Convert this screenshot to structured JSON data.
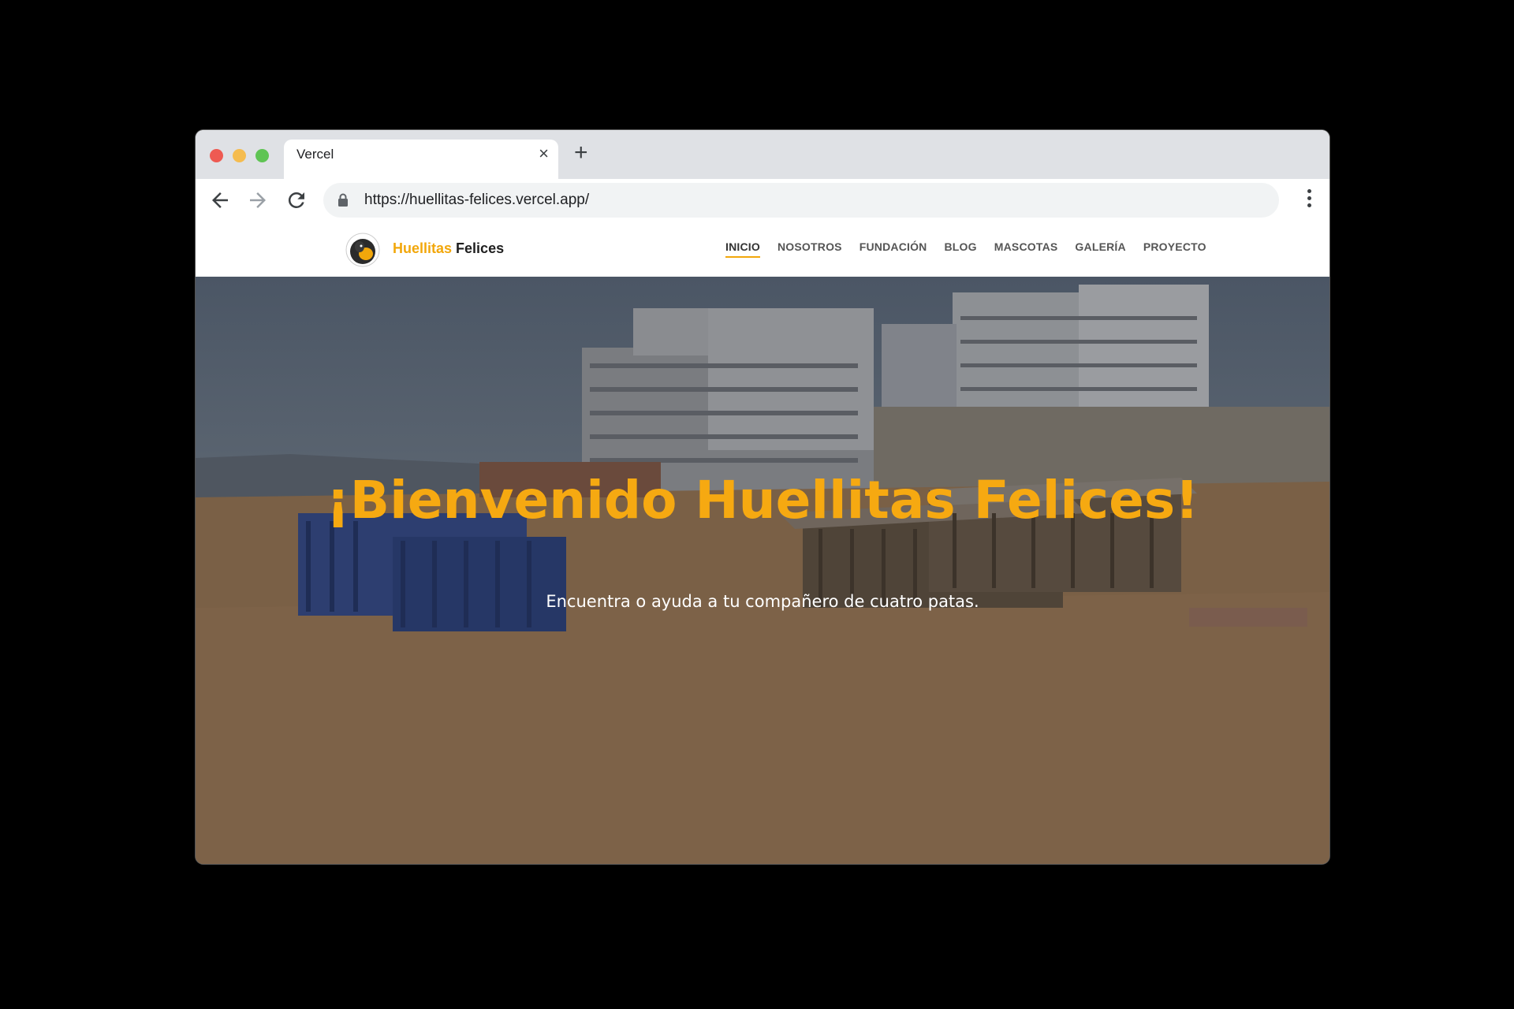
{
  "browser": {
    "tab_title": "Vercel",
    "tab_close": "×",
    "new_tab": "+",
    "url": "https://huellitas-felices.vercel.app/"
  },
  "site": {
    "brand_part1": "Huellitas",
    "brand_part2": "Felices",
    "nav": [
      {
        "label": "INICIO",
        "active": true
      },
      {
        "label": "NOSOTROS"
      },
      {
        "label": "FUNDACIÓN"
      },
      {
        "label": "BLOG"
      },
      {
        "label": "MASCOTAS"
      },
      {
        "label": "GALERÍA"
      },
      {
        "label": "PROYECTO"
      }
    ]
  },
  "hero": {
    "title": "¡Bienvenido Huellitas Felices!",
    "subtitle": "Encuentra o ayuda a tu compañero de cuatro patas."
  },
  "colors": {
    "accent": "#f2a70b",
    "hero_title": "#f6a911"
  }
}
